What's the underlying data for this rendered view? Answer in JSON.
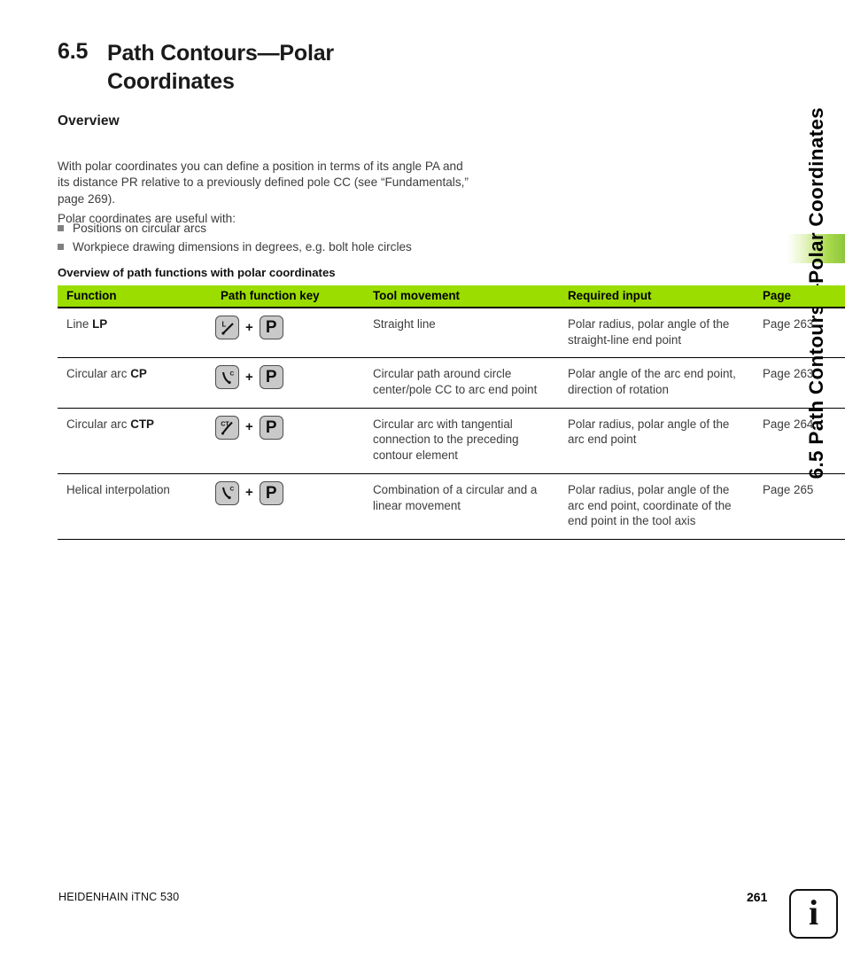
{
  "page": {
    "section_number": "6.5",
    "section_title": "Path Contours—Polar Coordinates",
    "running_head": "6.5 Path Contours—Polar Coordinates",
    "subheading": "Overview",
    "paragraph_1": "With polar coordinates you can define a position in terms of its angle PA and its distance PR relative to a previously defined pole CC (see “Fundamentals,” page 269).",
    "paragraph_2": "Polar coordinates are useful with:",
    "bullets": [
      "Positions on circular arcs",
      "Workpiece drawing dimensions in degrees, e.g. bolt hole circles"
    ],
    "table_caption": "Overview of path functions with polar coordinates"
  },
  "table": {
    "headers": [
      "Function",
      "Path function key",
      "Tool movement",
      "Required input",
      "Page"
    ],
    "rows": [
      {
        "function_label": "Line",
        "function_code": "LP",
        "key_icon": "line-path-key-icon",
        "key_icon_label": "L",
        "plus": "+",
        "polar_key": "P",
        "tool_movement": "Straight line",
        "required_input": "Polar radius, polar angle of the straight-line end point",
        "page": "Page 263"
      },
      {
        "function_label": "Circular arc",
        "function_code": "CP",
        "key_icon": "circular-arc-c-key-icon",
        "key_icon_label": "C",
        "plus": "+",
        "polar_key": "P",
        "tool_movement": "Circular path around circle center/pole CC to arc end point",
        "required_input": "Polar angle of the arc end point, direction of rotation",
        "page": "Page 263"
      },
      {
        "function_label": "Circular arc",
        "function_code": "CTP",
        "key_icon": "circular-arc-ct-key-icon",
        "key_icon_label": "CT",
        "plus": "+",
        "polar_key": "P",
        "tool_movement": "Circular arc with tangential connection to the preceding contour element",
        "required_input": "Polar radius, polar angle of the arc end point",
        "page": "Page 264"
      },
      {
        "function_label": "Helical interpolation",
        "function_code": "",
        "key_icon": "circular-arc-c-key-icon",
        "key_icon_label": "C",
        "plus": "+",
        "polar_key": "P",
        "tool_movement": "Combination of a circular and a linear movement",
        "required_input": "Polar radius, polar angle of the arc end point, coordinate of the end point in the tool axis",
        "page": "Page 265"
      }
    ]
  },
  "footer": {
    "brand": "HEIDENHAIN iTNC 530",
    "page_number": "261",
    "info_icon_label": "i"
  },
  "colors": {
    "header_green": "#9cdd00",
    "tab_green": "#8cc63f",
    "key_gray": "#c9c9c9",
    "body_text": "#3c3c3c"
  }
}
